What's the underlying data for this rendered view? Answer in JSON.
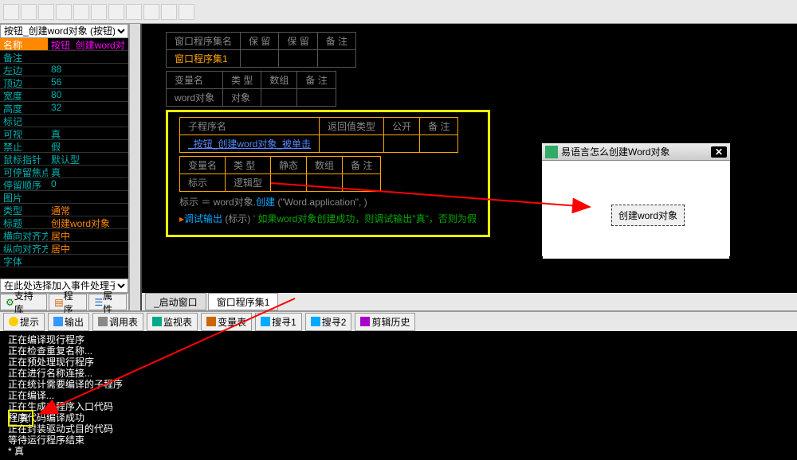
{
  "toolbar": {},
  "left": {
    "object_selector": "按钮_创建word对象 (按钮)",
    "props": [
      {
        "label": "名称",
        "value": "按钮_创建word对",
        "hl": true
      },
      {
        "label": "备注",
        "value": ""
      },
      {
        "label": "左边",
        "value": "88"
      },
      {
        "label": "顶边",
        "value": "56"
      },
      {
        "label": "宽度",
        "value": "80"
      },
      {
        "label": "高度",
        "value": "32"
      },
      {
        "label": "标记",
        "value": ""
      },
      {
        "label": "可视",
        "value": "真"
      },
      {
        "label": "禁止",
        "value": "假"
      },
      {
        "label": "鼠标指针",
        "value": "默认型"
      },
      {
        "label": "可停留焦点",
        "value": "真"
      },
      {
        "label": "停留顺序",
        "value": "0"
      },
      {
        "label": "图片",
        "value": ""
      },
      {
        "label": "类型",
        "value": "通常",
        "orange": true
      },
      {
        "label": "标题",
        "value": "创建word对象",
        "orange": true
      },
      {
        "label": "横向对齐方式",
        "value": "居中",
        "orange": true
      },
      {
        "label": "纵向对齐方式",
        "value": "居中",
        "orange": true
      },
      {
        "label": "字体",
        "value": ""
      }
    ],
    "event_selector": "在此处选择加入事件处理子程序",
    "tabs": [
      "支持库",
      "程序",
      "属性"
    ]
  },
  "code": {
    "table1": {
      "headers": [
        "窗口程序集名",
        "保 留",
        "保 留",
        "备 注"
      ],
      "row": [
        "窗口程序集1",
        "",
        "",
        ""
      ]
    },
    "table2": {
      "headers": [
        "变量名",
        "类 型",
        "数组",
        "备 注"
      ],
      "row": [
        "word对象",
        "对象",
        "",
        ""
      ]
    },
    "table3": {
      "headers": [
        "子程序名",
        "返回值类型",
        "公开",
        "备 注"
      ],
      "row": [
        "_按钮_创建word对象_被单击",
        "",
        "",
        ""
      ]
    },
    "table4": {
      "headers": [
        "变量名",
        "类 型",
        "静态",
        "数组",
        "备 注"
      ],
      "row": [
        "标示",
        "逻辑型",
        "",
        "",
        ""
      ]
    },
    "line1_a": "标示 ＝ word对象.",
    "line1_b": "创建",
    "line1_c": " (\"Word.application\", )",
    "line2_a": "调试输出",
    "line2_b": " (标示)  ",
    "line2_c": "' 如果word对象创建成功，则调试输出\"真\"，否则为假",
    "tabs": [
      "_启动窗口",
      "窗口程序集1"
    ]
  },
  "bottom": {
    "tabs": [
      "提示",
      "输出",
      "调用表",
      "监视表",
      "变量表",
      "搜寻1",
      "搜寻2",
      "剪辑历史"
    ],
    "output": "正在编译现行程序\n正在检查重复名称...\n正在预处理现行程序\n正在进行名称连接...\n正在统计需要编译的子程序\n正在编译...\n正在生成主程序入口代码\n程序代码编译成功\n正在封装驱动式目的代码\n等待运行程序结束\n* 真",
    "true_marker": "* 真"
  },
  "popup": {
    "title": "易语言怎么创建Word对象",
    "close": "✕",
    "button": "创建word对象"
  }
}
